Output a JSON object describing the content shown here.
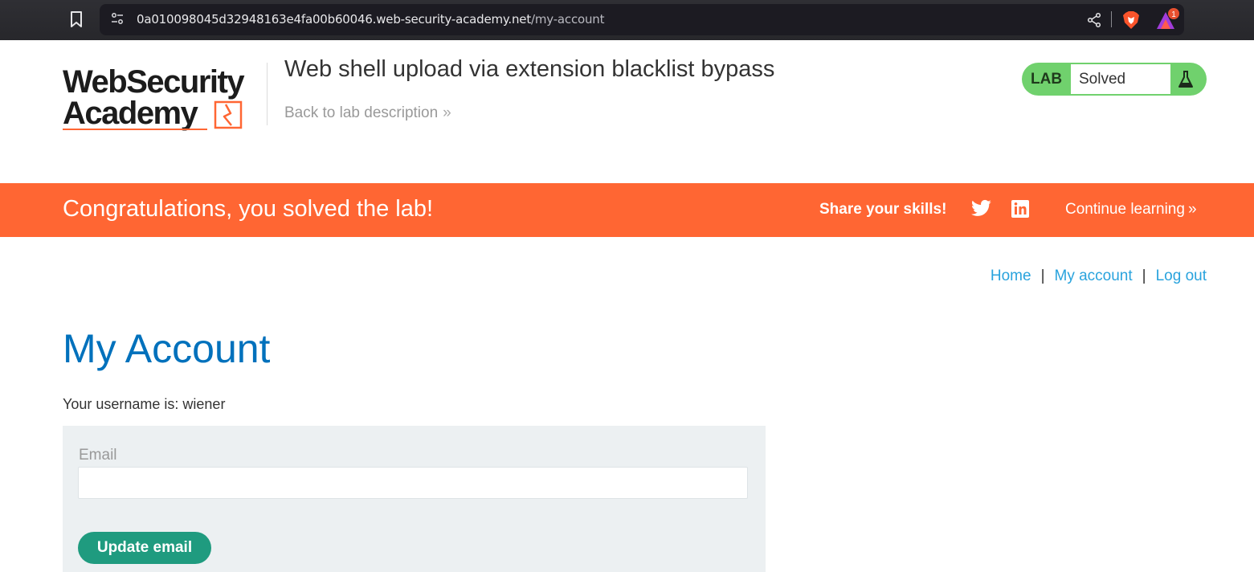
{
  "browser": {
    "url_host": "0a010098045d32948163e4fa00b60046.web-security-academy.net",
    "url_path": "/my-account",
    "icons": [
      "bookmark-icon",
      "tune-icon",
      "share-icon",
      "brave-shield-icon",
      "brave-rewards-icon"
    ],
    "rewards_badge_count": "1"
  },
  "header": {
    "logo_line1": "WebSecurity",
    "logo_line2": "Academy",
    "lab_title": "Web shell upload via extension blacklist bypass",
    "back_link": "Back to lab description",
    "lab_badge_label": "LAB",
    "lab_status": "Solved"
  },
  "banner": {
    "message": "Congratulations, you solved the lab!",
    "share_label": "Share your skills!",
    "continue_label": "Continue learning",
    "color": "#ff6633"
  },
  "nav": {
    "home": "Home",
    "my_account": "My account",
    "log_out": "Log out",
    "separator": "|"
  },
  "main": {
    "page_title": "My Account",
    "username_line": "Your username is: wiener",
    "email_label": "Email",
    "email_value": "",
    "update_button": "Update email"
  },
  "colors": {
    "title_blue": "#0071bc",
    "link_blue": "#29a3dd",
    "badge_green": "#70d16d",
    "button_green": "#1f9b7f",
    "form_bg": "#ecf0f2"
  }
}
